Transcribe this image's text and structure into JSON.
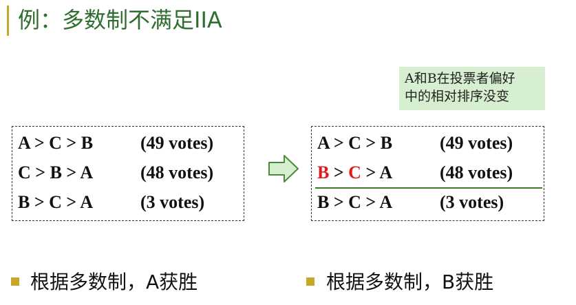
{
  "title": "例：多数制不满足IIA",
  "note": {
    "line1": "A和B在投票者偏好",
    "line2": "中的相对排序没变"
  },
  "left_panel": {
    "rows": [
      {
        "pref": "A > C > B",
        "votes": "(49 votes)"
      },
      {
        "pref": "C > B > A",
        "votes": "(48 votes)"
      },
      {
        "pref": "B > C > A",
        "votes": "(3 votes)"
      }
    ]
  },
  "right_panel": {
    "rows": [
      {
        "pref": "A > C > B",
        "votes": "(49 votes)"
      },
      {
        "pref_parts": [
          "B",
          " > ",
          "C",
          " > A"
        ],
        "votes": "(48 votes)"
      },
      {
        "pref": "B > C > A",
        "votes": "(3 votes)"
      }
    ]
  },
  "conclusions": {
    "left": "根据多数制，A获胜",
    "right": "根据多数制，B获胜"
  },
  "colors": {
    "title": "#2e6e2e",
    "accent": "#c8a82a",
    "highlight": "#e01a1a",
    "note_bg": "#d6efd0",
    "arrow_fill": "#d6efd0",
    "arrow_stroke": "#4a8a3a"
  },
  "icons": {
    "transition": "right-arrow-icon"
  }
}
